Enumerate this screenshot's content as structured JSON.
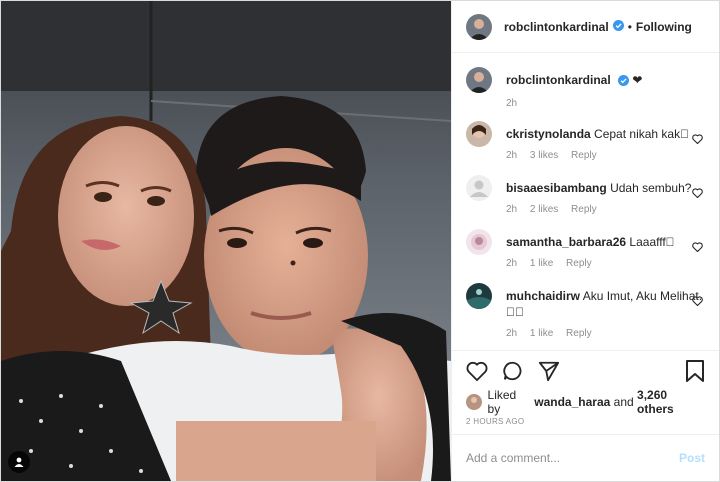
{
  "header": {
    "username": "robclintonkardinal",
    "separator": "•",
    "follow_label": "Following"
  },
  "caption": {
    "username": "robclintonkardinal",
    "text": "❤",
    "time": "2h"
  },
  "comments": [
    {
      "username": "ckristynolanda",
      "text": "Cepat nikah kak\u0000",
      "time": "2h",
      "likes": "3 likes",
      "reply": "Reply"
    },
    {
      "username": "bisaaesibambang",
      "text": "Udah sembuh?",
      "time": "2h",
      "likes": "2 likes",
      "reply": "Reply"
    },
    {
      "username": "samantha_barbara26",
      "text": "Laaafff\u0000",
      "time": "2h",
      "likes": "1 like",
      "reply": "Reply"
    },
    {
      "username": "muhchaidirw",
      "text": "Aku Imut, Aku Melihat. \u0000\u0000",
      "time": "2h",
      "likes": "1 like",
      "reply": "Reply"
    }
  ],
  "likes": {
    "prefix": "Liked by",
    "user": "wanda_haraa",
    "middle": "and",
    "others": "3,260 others"
  },
  "timestamp": "2 HOURS AGO",
  "add_comment": {
    "placeholder": "Add a comment...",
    "post_label": "Post"
  },
  "colors": {
    "verified": "#3897f0",
    "post_disabled": "#b2dffc",
    "meta_gray": "#8e8e8e"
  }
}
